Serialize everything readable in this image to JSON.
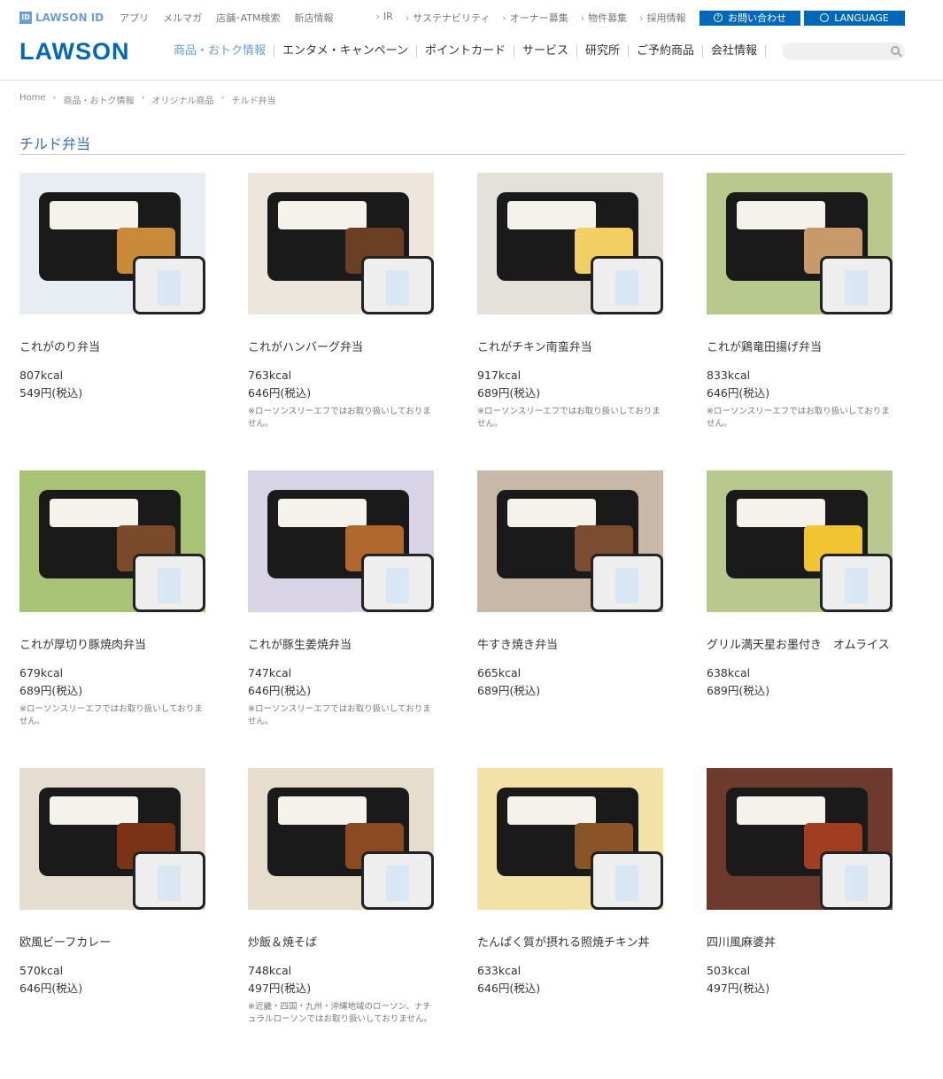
{
  "utilbar": {
    "lawson_id_label": "LAWSON ID",
    "links": [
      "アプリ",
      "メルマガ",
      "店舗･ATM検索",
      "新店情報"
    ],
    "links2": [
      "IR",
      "サステナビリティ",
      "オーナー募集",
      "物件募集",
      "採用情報"
    ],
    "contact_label": "お問い合わせ",
    "language_label": "LANGUAGE"
  },
  "header": {
    "logo": "LAWSON",
    "nav": [
      "商品・おトク情報",
      "エンタメ・キャンペーン",
      "ポイントカード",
      "サービス",
      "研究所",
      "ご予約商品",
      "会社情報"
    ],
    "search_placeholder": ""
  },
  "breadcrumb": [
    "Home",
    "商品・おトク情報",
    "オリジナル商品",
    "チルド弁当"
  ],
  "page_title": "チルド弁当",
  "products": [
    {
      "name": "これがのり弁当",
      "kcal": "807kcal",
      "price": "549円(税込)",
      "note": "",
      "bg": "#e8ecf3",
      "side": "#c98a3a"
    },
    {
      "name": "これがハンバーグ弁当",
      "kcal": "763kcal",
      "price": "646円(税込)",
      "note": "※ローソンスリーエフではお取り扱いしておりません。",
      "bg": "#ece6dc",
      "side": "#6b3f24"
    },
    {
      "name": "これがチキン南蛮弁当",
      "kcal": "917kcal",
      "price": "689円(税込)",
      "note": "※ローソンスリーエフではお取り扱いしておりません。",
      "bg": "#e4e1da",
      "side": "#f2cf63"
    },
    {
      "name": "これが鶏竜田揚げ弁当",
      "kcal": "833kcal",
      "price": "646円(税込)",
      "note": "※ローソンスリーエフではお取り扱いしておりません。",
      "bg": "#b9c98d",
      "side": "#c89a6a"
    },
    {
      "name": "これが厚切り豚焼肉弁当",
      "kcal": "679kcal",
      "price": "689円(税込)",
      "note": "※ローソンスリーエフではお取り扱いしておりません。",
      "bg": "#a9c376",
      "side": "#7a4a2b"
    },
    {
      "name": "これが豚生姜焼弁当",
      "kcal": "747kcal",
      "price": "646円(税込)",
      "note": "※ローソンスリーエフではお取り扱いしておりません。",
      "bg": "#d8d4e6",
      "side": "#b0682f"
    },
    {
      "name": "牛すき焼き弁当",
      "kcal": "665kcal",
      "price": "689円(税込)",
      "note": "",
      "bg": "#c7b8a8",
      "side": "#7b4c2f"
    },
    {
      "name": "グリル満天星お墨付き　オムライス",
      "kcal": "638kcal",
      "price": "689円(税込)",
      "note": "",
      "bg": "#b8c88e",
      "side": "#f1c531"
    },
    {
      "name": "欧風ビーフカレー",
      "kcal": "570kcal",
      "price": "646円(税込)",
      "note": "",
      "bg": "#e4ddd0",
      "side": "#7b3318"
    },
    {
      "name": "炒飯＆焼そば",
      "kcal": "748kcal",
      "price": "497円(税込)",
      "note": "※近畿・四国・九州・沖縄地域のローソン、ナチュラルローソンではお取り扱いしておりません。",
      "bg": "#e6ddcc",
      "side": "#8a4a22"
    },
    {
      "name": "たんぱく質が摂れる照焼チキン丼",
      "kcal": "633kcal",
      "price": "646円(税込)",
      "note": "",
      "bg": "#f3e2a8",
      "side": "#8a5428"
    },
    {
      "name": "四川風麻婆丼",
      "kcal": "503kcal",
      "price": "497円(税込)",
      "note": "",
      "bg": "#6e3a2e",
      "side": "#a13d20"
    }
  ]
}
